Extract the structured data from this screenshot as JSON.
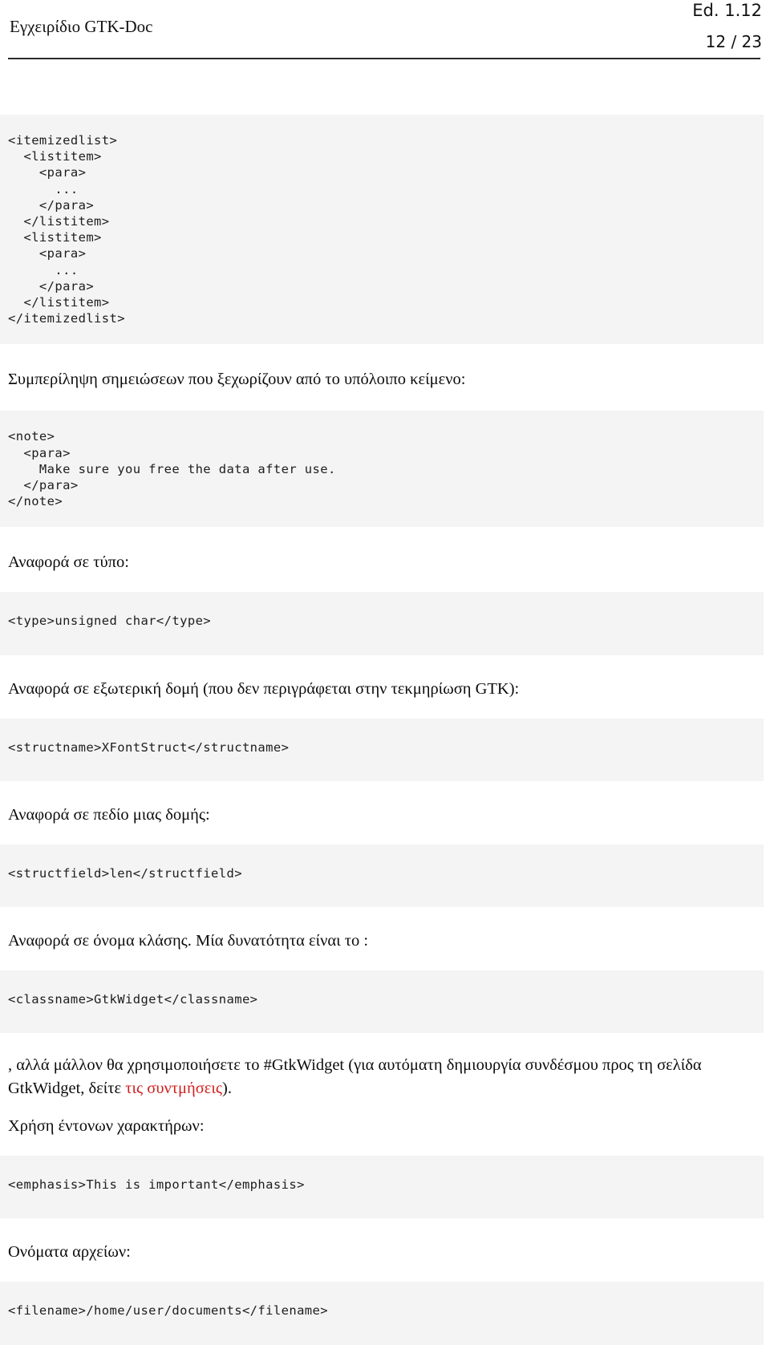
{
  "header": {
    "doc_title": "Εγχειρίδιο GTK-Doc",
    "edition": "Ed. 1.12",
    "page_indicator": "12 / 23"
  },
  "blocks": {
    "itemizedlist_code": "<itemizedlist>\n  <listitem>\n    <para>\n      ...\n    </para>\n  </listitem>\n  <listitem>\n    <para>\n      ...\n    </para>\n  </listitem>\n</itemizedlist>",
    "note_intro": "Συμπερίληψη σημειώσεων που ξεχωρίζουν από το υπόλοιπο κείμενο:",
    "note_code": "<note>\n  <para>\n    Make sure you free the data after use.\n  </para>\n</note>",
    "type_intro": "Αναφορά σε τύπο:",
    "type_code": "<type>unsigned char</type>",
    "structname_intro": "Αναφορά σε εξωτερική δομή (που δεν περιγράφεται στην τεκμηρίωση GTK):",
    "structname_code": "<structname>XFontStruct</structname>",
    "structfield_intro": "Αναφορά σε πεδίο μιας δομής:",
    "structfield_code": "<structfield>len</structfield>",
    "classname_intro": "Αναφορά σε όνομα κλάσης. Μία δυνατότητα είναι το :",
    "classname_code": "<classname>GtkWidget</classname>",
    "widget_note_part1": ", αλλά μάλλον θα χρησιμοποιήσετε το #GtkWidget (για αυτόματη δημιουργία συνδέσμου προς τη σελίδα GtkWidget, δείτε ",
    "widget_note_link": "τις συντμήσεις",
    "widget_note_part2": ").",
    "emphasis_intro": "Χρήση έντονων χαρακτήρων:",
    "emphasis_code": "<emphasis>This is important</emphasis>",
    "filename_intro": "Ονόματα αρχείων:",
    "filename_code": "<filename>/home/user/documents</filename>"
  },
  "colors": {
    "code_background": "#f4f4f4",
    "link": "#d11f1f",
    "text": "#0d0d0d",
    "rule": "#2b2b2b"
  }
}
